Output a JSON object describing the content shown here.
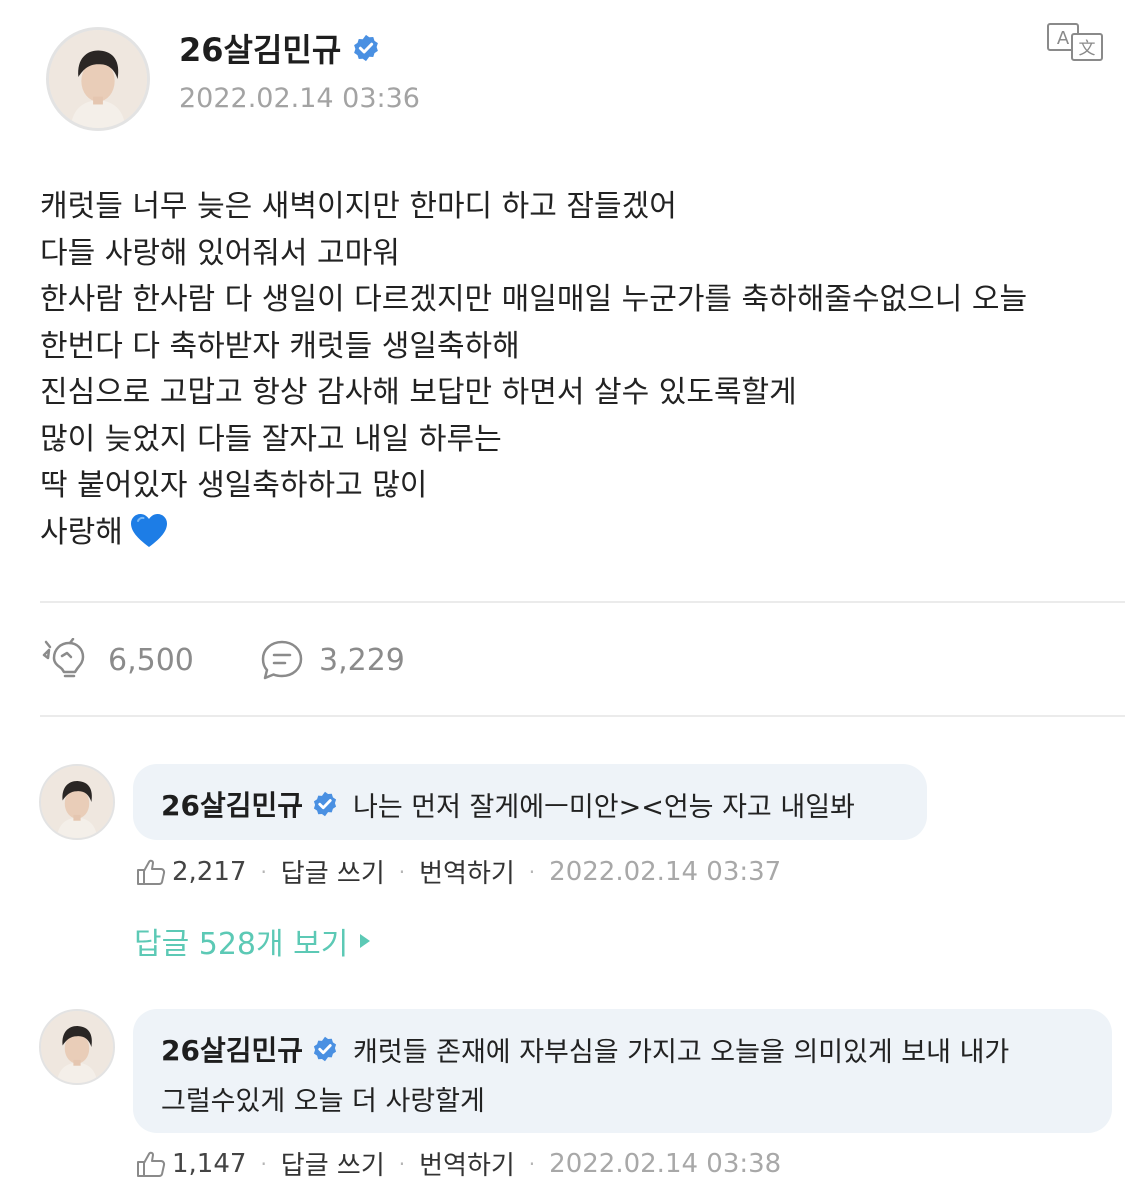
{
  "post": {
    "author": "26살김민규",
    "date": "2022.02.14 03:36",
    "lines": [
      "캐럿들 너무 늦은 새벽이지만 한마디 하고 잠들겠어",
      "다들 사랑해 있어줘서 고마워",
      "한사람 한사람 다 생일이 다르겠지만 매일매일 누군가를 축하해줄수없으니 오늘",
      "한번다 다 축하받자 캐럿들 생일축하해",
      "진심으로 고맙고 항상 감사해 보답만 하면서 살수 있도록할게",
      "많이 늦었지 다들 잘자고 내일 하루는",
      "딱 붙어있자 생일축하하고 많이",
      "사랑해"
    ],
    "heart_emoji": "blue-heart",
    "likes": "6,500",
    "comments_count": "3,229"
  },
  "comments": [
    {
      "author": "26살김민규",
      "text_line1": "나는 먼저 잘게에ㅡ미안><언능 자고 내일봐",
      "text_line2": "",
      "likes": "2,217",
      "reply": "답글 쓰기",
      "translate": "번역하기",
      "date": "2022.02.14 03:37"
    },
    {
      "author": "26살김민규",
      "text_line1": "캐럿들 존재에 자부심을 가지고 오늘을 의미있게 보내 내가",
      "text_line2": "그럴수있게 오늘 더 사랑할게",
      "likes": "1,147",
      "reply": "답글 쓰기",
      "translate": "번역하기",
      "date": "2022.02.14 03:38"
    }
  ],
  "view_replies": "답글 528개 보기",
  "colors": {
    "verified": "#4a90e2",
    "reply_link": "#5cc9b5",
    "bubble": "#eef3f8",
    "muted": "#a3a3a3"
  },
  "icons": {
    "translate": "translate-icon",
    "like": "bulb-cheer-icon",
    "comment": "speech-bubble-icon",
    "thumb": "thumbs-up-icon",
    "verified": "verified-badge-icon",
    "arrow": "triangle-right-icon"
  }
}
